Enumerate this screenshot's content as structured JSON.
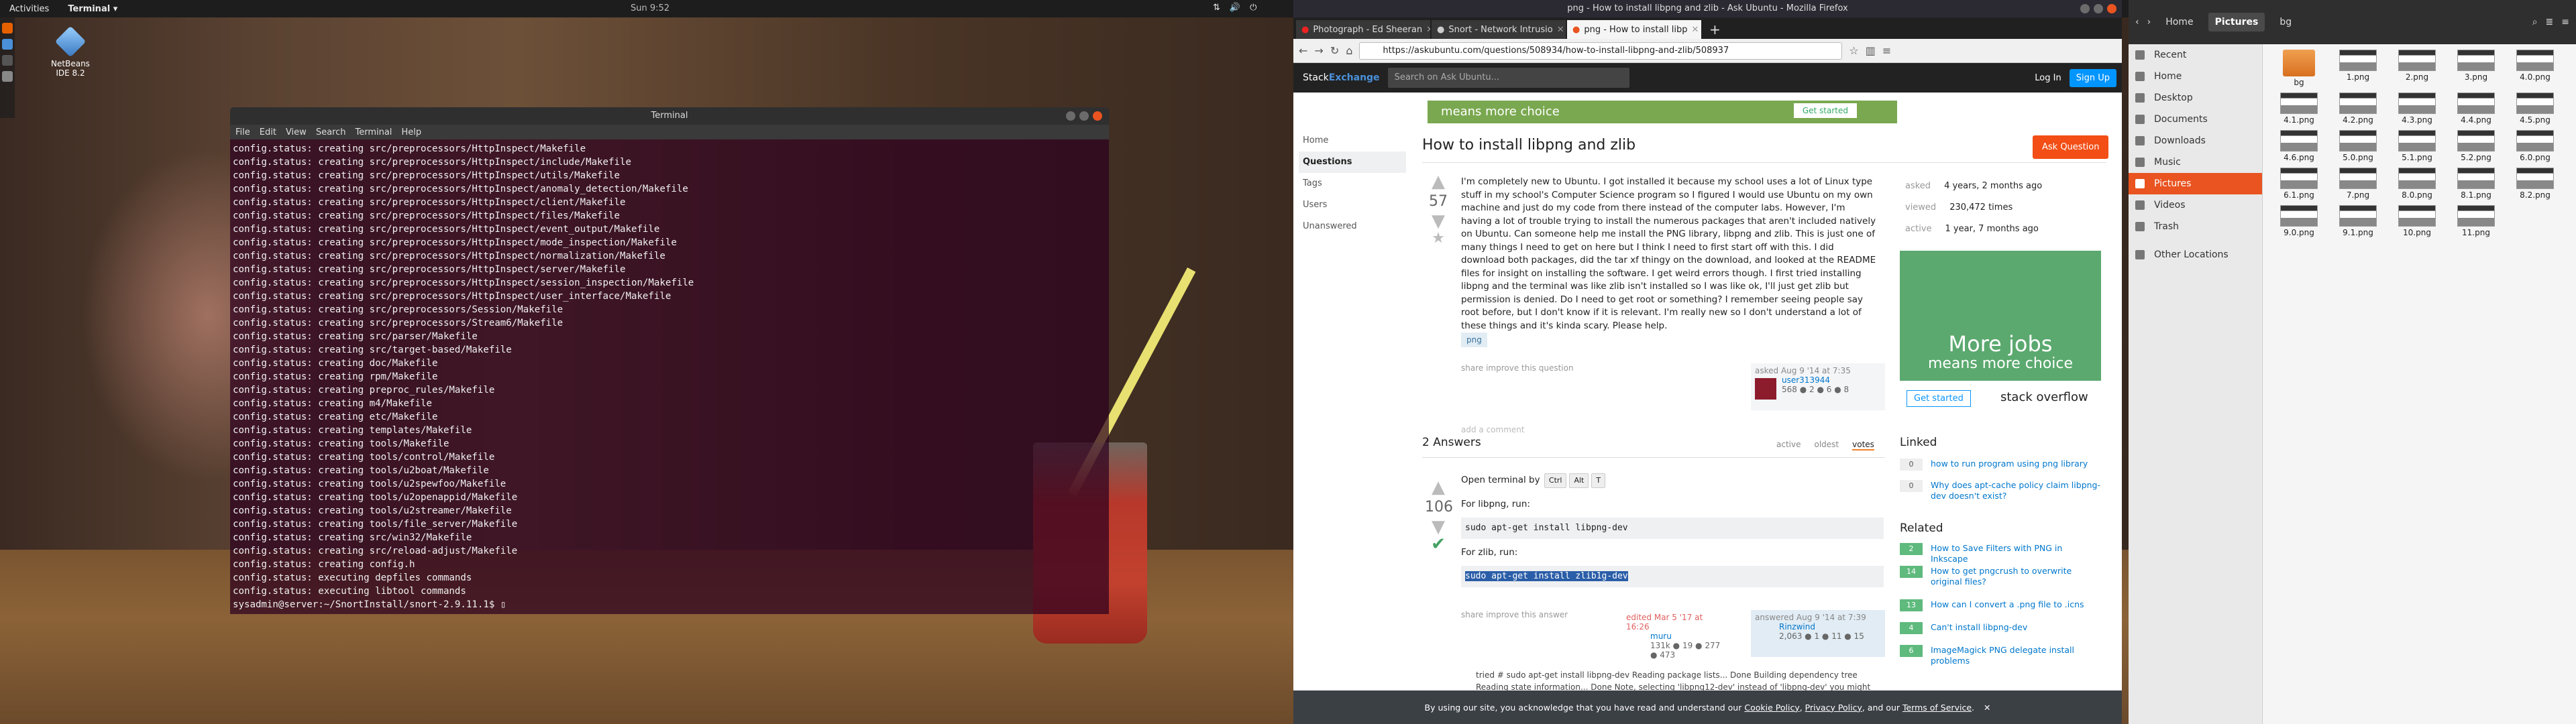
{
  "topbar": {
    "activities": "Activities",
    "app": "Terminal ▾",
    "clock": "Sun 9:52"
  },
  "desktop": {
    "netbeans_label": "NetBeans IDE 8.2"
  },
  "terminal": {
    "title": "Terminal",
    "menu": [
      "File",
      "Edit",
      "View",
      "Search",
      "Terminal",
      "Help"
    ],
    "lines": [
      "config.status: creating src/preprocessors/HttpInspect/Makefile",
      "config.status: creating src/preprocessors/HttpInspect/include/Makefile",
      "config.status: creating src/preprocessors/HttpInspect/utils/Makefile",
      "config.status: creating src/preprocessors/HttpInspect/anomaly_detection/Makefile",
      "config.status: creating src/preprocessors/HttpInspect/client/Makefile",
      "config.status: creating src/preprocessors/HttpInspect/files/Makefile",
      "config.status: creating src/preprocessors/HttpInspect/event_output/Makefile",
      "config.status: creating src/preprocessors/HttpInspect/mode_inspection/Makefile",
      "config.status: creating src/preprocessors/HttpInspect/normalization/Makefile",
      "config.status: creating src/preprocessors/HttpInspect/server/Makefile",
      "config.status: creating src/preprocessors/HttpInspect/session_inspection/Makefile",
      "config.status: creating src/preprocessors/HttpInspect/user_interface/Makefile",
      "config.status: creating src/preprocessors/Session/Makefile",
      "config.status: creating src/preprocessors/Stream6/Makefile",
      "config.status: creating src/parser/Makefile",
      "config.status: creating src/target-based/Makefile",
      "config.status: creating doc/Makefile",
      "config.status: creating rpm/Makefile",
      "config.status: creating preproc_rules/Makefile",
      "config.status: creating m4/Makefile",
      "config.status: creating etc/Makefile",
      "config.status: creating templates/Makefile",
      "config.status: creating tools/Makefile",
      "config.status: creating tools/control/Makefile",
      "config.status: creating tools/u2boat/Makefile",
      "config.status: creating tools/u2spewfoo/Makefile",
      "config.status: creating tools/u2openappid/Makefile",
      "config.status: creating tools/u2streamer/Makefile",
      "config.status: creating tools/file_server/Makefile",
      "config.status: creating src/win32/Makefile",
      "config.status: creating src/reload-adjust/Makefile",
      "config.status: creating config.h",
      "config.status: executing depfiles commands",
      "config.status: executing libtool commands",
      "sysadmin@server:~/SnortInstall/snort-2.9.11.1$ "
    ]
  },
  "firefox": {
    "window_title": "png - How to install libpng and zlib - Ask Ubuntu - Mozilla Firefox",
    "tabs": [
      "Photograph - Ed Sheeran",
      "Snort - Network Intrusio",
      "png - How to install libp"
    ],
    "url": "https://askubuntu.com/questions/508934/how-to-install-libpng-and-zlib/508937"
  },
  "se": {
    "logo_a": "Stack",
    "logo_b": "Exchange",
    "search_placeholder": "Search on Ask Ubuntu...",
    "login": "Log In",
    "signup": "Sign Up",
    "nav": [
      "Home",
      "Questions",
      "Tags",
      "Users",
      "Unanswered"
    ],
    "banner_text": "means more choice",
    "banner_btn": "Get started",
    "ask_button": "Ask Question",
    "question": {
      "title": "How to install libpng and zlib",
      "votes": "57",
      "body": "I'm completely new to Ubuntu. I got installed it because my school uses a lot of Linux type stuff in my school's Computer Science program so I figured I would use Ubuntu on my own machine and just do my code from there instead of the computer labs. However, I'm having a lot of trouble trying to install the numerous packages that aren't included natively on Ubuntu. Can someone help me install the PNG library, libpng and zlib. This is just one of many things I need to get on here but I think I need to first start off with this. I did download both packages, did the tar xf thingy on the download, and looked at the README files for insight on installing the software. I get weird errors though. I first tried installing libpng and the terminal was like zlib isn't installed so I was like ok, I'll just get zlib but permission is denied. Do I need to get root or something? I remember seeing people say root before, but I don't know if it is relevant. I'm really new so I don't understand a lot of these things and it's kinda scary. Please help.",
      "tag": "png",
      "share": "share  improve this question",
      "asked_when": "asked Aug 9 '14 at 7:35",
      "owner": "user313944",
      "owner_rep": "568 ● 2 ● 6 ● 8",
      "add_comment": "add a comment",
      "stats": [
        [
          "asked",
          "4 years, 2 months ago"
        ],
        [
          "viewed",
          "230,472 times"
        ],
        [
          "active",
          "1 year, 7 months ago"
        ]
      ]
    },
    "ad": {
      "line1": "More jobs",
      "line2": "means more choice",
      "btn": "Get started",
      "brand": "stack overflow"
    },
    "answers": {
      "heading": "2 Answers",
      "sort": [
        "active",
        "oldest",
        "votes"
      ],
      "votes": "106",
      "open_term": "Open terminal by",
      "keys": [
        "Ctrl",
        "Alt",
        "T"
      ],
      "for_libpng": "For libpng, run:",
      "cmd1": "sudo apt-get install libpng-dev",
      "for_zlib": "For zlib, run:",
      "cmd2": "sudo apt-get install zlib1g-dev",
      "share": "share  improve this answer",
      "edited": "edited Mar 5 '17 at 16:26",
      "editor": "muru",
      "editor_rep": "131k ● 19 ● 277 ● 473",
      "answered": "answered Aug 9 '14 at 7:39",
      "answerer": "Rinzwind",
      "answerer_rep": "2,063 ● 1 ● 11 ● 15",
      "comment": "tried # sudo apt-get install libpng-dev Reading package lists... Done Building dependency tree Reading state information... Done Note, selecting 'libpng12-dev' instead of 'libpng-dev' you might want to run"
    },
    "linked": {
      "heading": "Linked",
      "items": [
        [
          "0",
          "how to run program using png library"
        ],
        [
          "0",
          "Why does apt-cache policy claim libpng-dev doesn't exist?"
        ]
      ]
    },
    "related": {
      "heading": "Related",
      "items": [
        [
          "2",
          "How to Save Filters with PNG in Inkscape"
        ],
        [
          "14",
          "How to get pngcrush to overwrite original files?"
        ],
        [
          "13",
          "How can I convert a .png file to .icns"
        ],
        [
          "4",
          "Can't install libpng-dev"
        ],
        [
          "6",
          "ImageMagick PNG delegate install problems"
        ]
      ]
    },
    "cookie": {
      "text": "By using our site, you acknowledge that you have read and understand our",
      "cookie_policy": "Cookie Policy",
      "privacy": "Privacy Policy",
      "and_our": ", and our",
      "tos": "Terms of Service",
      "close": "✕"
    }
  },
  "files": {
    "crumbs": [
      "Home",
      "Pictures",
      "bg"
    ],
    "sidebar": [
      "Recent",
      "Home",
      "Desktop",
      "Documents",
      "Downloads",
      "Music",
      "Pictures",
      "Videos",
      "Trash",
      "Other Locations"
    ],
    "items": [
      "bg",
      "1.png",
      "2.png",
      "3.png",
      "4.0.png",
      "4.1.png",
      "4.2.png",
      "4.3.png",
      "4.4.png",
      "4.5.png",
      "4.6.png",
      "5.0.png",
      "5.1.png",
      "5.2.png",
      "6.0.png",
      "6.1.png",
      "7.png",
      "8.0.png",
      "8.1.png",
      "8.2.png",
      "9.0.png",
      "9.1.png",
      "10.png",
      "11.png"
    ]
  }
}
